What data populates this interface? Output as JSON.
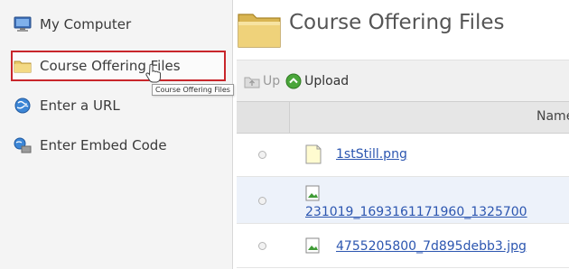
{
  "sidebar": {
    "items": [
      {
        "label": "My Computer",
        "icon": "computer-icon"
      },
      {
        "label": "Course Offering Files",
        "icon": "folder-icon"
      },
      {
        "label": "Enter a URL",
        "icon": "globe-icon"
      },
      {
        "label": "Enter Embed Code",
        "icon": "embed-code-icon"
      }
    ],
    "selected_index": 1,
    "tooltip": "Course Offering Files"
  },
  "main": {
    "title": "Course Offering Files",
    "toolbar": {
      "up_label": "Up",
      "upload_label": "Upload"
    },
    "table": {
      "name_header": "Name",
      "rows": [
        {
          "name": "1stStill.png",
          "icon": "file-icon"
        },
        {
          "name": "231019_1693161171960_1325700",
          "icon": "image-file-icon"
        },
        {
          "name": "4755205800_7d895debb3.jpg",
          "icon": "image-file-icon"
        }
      ]
    }
  },
  "colors": {
    "selection_border": "#c8262b",
    "link": "#2c56b0",
    "folder": "#e9c96a",
    "upload_green": "#4aa63a"
  }
}
